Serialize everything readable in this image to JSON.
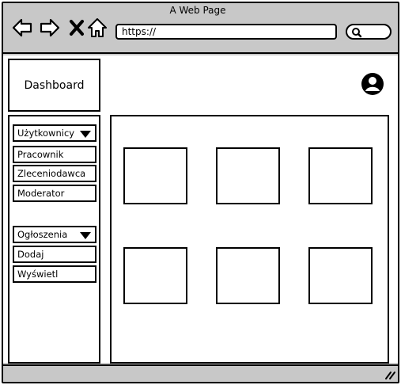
{
  "window": {
    "title": "A Web Page"
  },
  "toolbar": {
    "url": "https://",
    "icons": [
      "back-arrow-icon",
      "forward-arrow-icon",
      "close-icon",
      "home-icon",
      "search-icon"
    ]
  },
  "header": {
    "logo_label": "Dashboard",
    "avatar_icon": "user-avatar-icon"
  },
  "sidebar": {
    "users_dropdown": "Użytkownicy",
    "users_items": [
      "Pracownik",
      "Zleceniodawca",
      "Moderator"
    ],
    "ads_dropdown": "Ogłoszenia",
    "ads_items": [
      "Dodaj",
      "Wyświetl"
    ]
  },
  "main": {
    "tiles_count": 6
  },
  "colors": {
    "chrome": "#c8c8c8",
    "border": "#000000",
    "background": "#ffffff"
  }
}
